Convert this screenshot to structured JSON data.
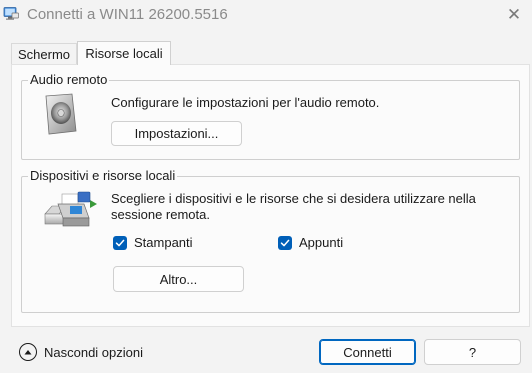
{
  "window": {
    "title": "Connetti a WIN11 26200.5516",
    "close_glyph": "✕"
  },
  "tabs": [
    {
      "label": "Schermo",
      "active": false
    },
    {
      "label": "Risorse locali",
      "active": true
    }
  ],
  "audio_group": {
    "title": "Audio remoto",
    "description": "Configurare le impostazioni per l'audio remoto.",
    "settings_button": "Impostazioni...",
    "icon": "speaker-icon"
  },
  "devices_group": {
    "title": "Dispositivi e risorse locali",
    "description_line1": "Scegliere i dispositivi e le risorse che si desidera utilizzare nella",
    "description_line2": "sessione remota.",
    "icon": "printer-icon",
    "printers": {
      "label": "Stampanti",
      "checked": true
    },
    "clipboard": {
      "label": "Appunti",
      "checked": true
    },
    "more_button": "Altro..."
  },
  "footer": {
    "hide_options": "Nascondi opzioni",
    "connect_button": "Connetti",
    "help_button": "?"
  },
  "colors": {
    "accent": "#005fb8",
    "primary_border": "#0067c0"
  }
}
